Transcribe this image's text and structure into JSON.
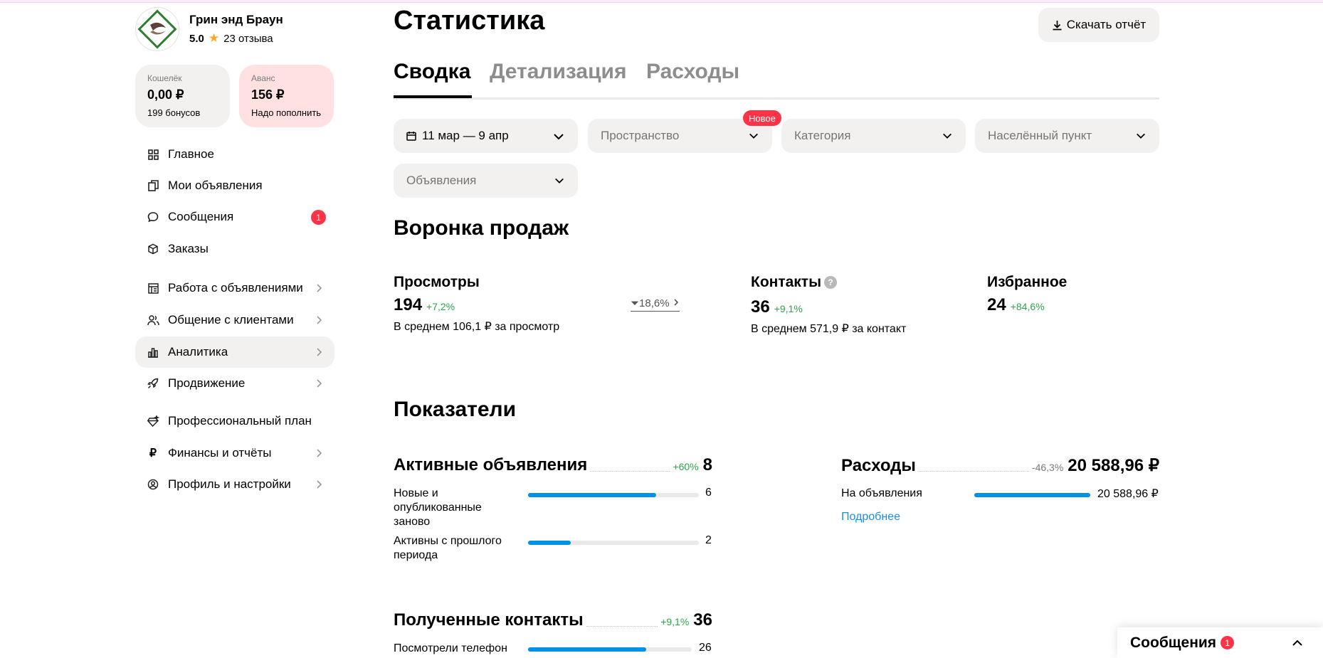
{
  "seller": {
    "name": "Грин энд Браун",
    "rating": "5.0",
    "reviews": "23 отзыва"
  },
  "wallet": {
    "label": "Кошелёк",
    "value": "0,00 ₽",
    "sub": "199 бонусов"
  },
  "advance": {
    "label": "Аванс",
    "value": "156 ₽",
    "sub": "Надо пополнить"
  },
  "nav": {
    "main": "Главное",
    "my_ads": "Мои объявления",
    "messages": "Сообщения",
    "messages_badge": "1",
    "orders": "Заказы",
    "ads_work": "Работа с объявлениями",
    "clients": "Общение с клиентами",
    "analytics": "Аналитика",
    "promotion": "Продвижение",
    "pro_plan": "Профессиональный план",
    "finance": "Финансы и отчёты",
    "profile": "Профиль и настройки"
  },
  "page": {
    "title": "Статистика",
    "download": "Скачать отчёт"
  },
  "tabs": [
    "Сводка",
    "Детализация",
    "Расходы"
  ],
  "filters": {
    "date": "11 мар — 9 апр",
    "space": "Пространство",
    "space_tag": "Новое",
    "category": "Категория",
    "city": "Населённый пункт",
    "ads": "Объявления"
  },
  "funnel": {
    "title": "Воронка продаж",
    "views": {
      "label": "Просмотры",
      "value": "194",
      "change": "+7,2%",
      "note": "В среднем 106,1 ₽ за просмотр"
    },
    "conversion": "18,6%",
    "contacts": {
      "label": "Контакты",
      "value": "36",
      "change": "+9,1%",
      "note": "В среднем 571,9 ₽ за контакт"
    },
    "favorites": {
      "label": "Избранное",
      "value": "24",
      "change": "+84,6%"
    }
  },
  "indicators": {
    "title": "Показатели",
    "active": {
      "label": "Активные объявления",
      "change": "+60%",
      "value": "8",
      "rows": [
        {
          "label": "Новые и опубликованные заново",
          "value": "6",
          "fill": 0.75
        },
        {
          "label": "Активны с прошлого периода",
          "value": "2",
          "fill": 0.25
        }
      ]
    },
    "expenses": {
      "label": "Расходы",
      "change": "-46,3%",
      "value": "20 588,96 ₽",
      "rows": [
        {
          "label": "На объявления",
          "value": "20 588,96 ₽",
          "fill": 1.0
        }
      ],
      "more": "Подробнее"
    },
    "contacts": {
      "label": "Полученные контакты",
      "change": "+9,1%",
      "value": "36",
      "rows": [
        {
          "label": "Посмотрели телефон",
          "value": "26",
          "fill": 0.72
        }
      ]
    }
  },
  "messenger": {
    "label": "Сообщения",
    "badge": "1"
  }
}
